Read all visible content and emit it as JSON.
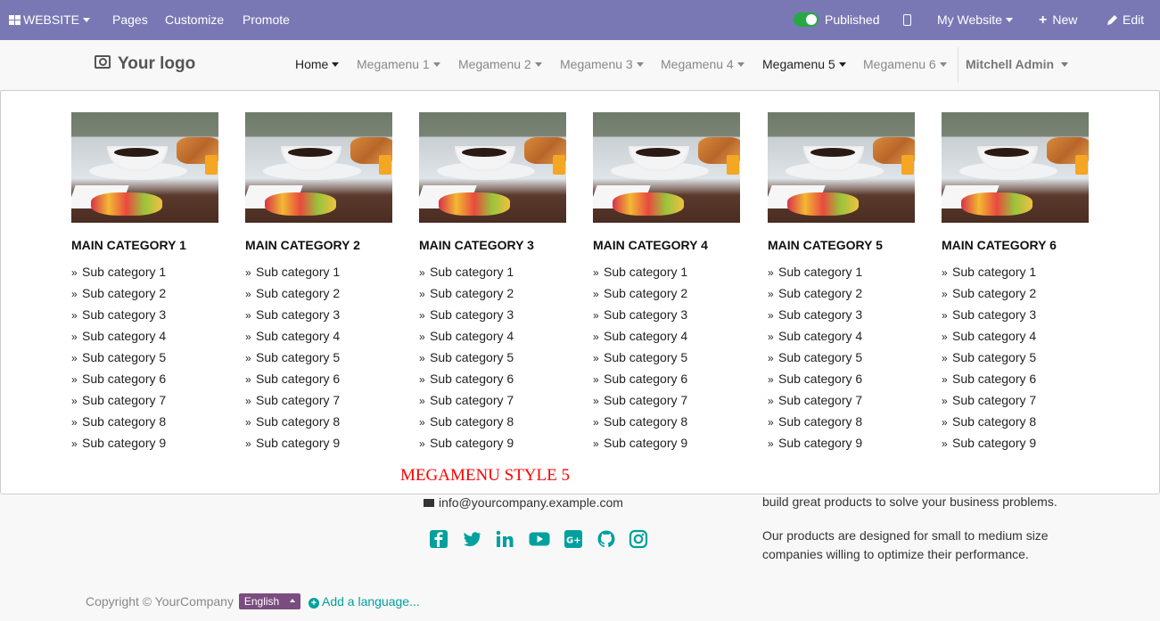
{
  "admin_bar": {
    "website_label": "WEBSITE",
    "pages_label": "Pages",
    "customize_label": "Customize",
    "promote_label": "Promote",
    "published_label": "Published",
    "my_website_label": "My Website",
    "new_label": "New",
    "edit_label": "Edit",
    "colors": {
      "background": "#7a78b4",
      "toggle_on": "#28a745"
    }
  },
  "navbar": {
    "logo_text": "Your logo",
    "items": [
      {
        "label": "Home",
        "active": true
      },
      {
        "label": "Megamenu 1",
        "active": false
      },
      {
        "label": "Megamenu 2",
        "active": false
      },
      {
        "label": "Megamenu 3",
        "active": false
      },
      {
        "label": "Megamenu 4",
        "active": false
      },
      {
        "label": "Megamenu 5",
        "active": true
      },
      {
        "label": "Megamenu 6",
        "active": false
      }
    ],
    "user_label": "Mitchell Admin"
  },
  "megamenu": {
    "style_label": "MEGAMENU STYLE 5",
    "label_color": "#ff0000",
    "columns": [
      {
        "title": "MAIN CATEGORY 1",
        "subs": [
          "Sub category 1",
          "Sub category 2",
          "Sub category 3",
          "Sub category 4",
          "Sub category 5",
          "Sub category 6",
          "Sub category 7",
          "Sub category 8",
          "Sub category 9"
        ]
      },
      {
        "title": "MAIN CATEGORY 2",
        "subs": [
          "Sub category 1",
          "Sub category 2",
          "Sub category 3",
          "Sub category 4",
          "Sub category 5",
          "Sub category 6",
          "Sub category 7",
          "Sub category 8",
          "Sub category 9"
        ]
      },
      {
        "title": "MAIN CATEGORY 3",
        "subs": [
          "Sub category 1",
          "Sub category 2",
          "Sub category 3",
          "Sub category 4",
          "Sub category 5",
          "Sub category 6",
          "Sub category 7",
          "Sub category 8",
          "Sub category 9"
        ]
      },
      {
        "title": "MAIN CATEGORY 4",
        "subs": [
          "Sub category 1",
          "Sub category 2",
          "Sub category 3",
          "Sub category 4",
          "Sub category 5",
          "Sub category 6",
          "Sub category 7",
          "Sub category 8",
          "Sub category 9"
        ]
      },
      {
        "title": "MAIN CATEGORY 5",
        "subs": [
          "Sub category 1",
          "Sub category 2",
          "Sub category 3",
          "Sub category 4",
          "Sub category 5",
          "Sub category 6",
          "Sub category 7",
          "Sub category 8",
          "Sub category 9"
        ]
      },
      {
        "title": "MAIN CATEGORY 6",
        "subs": [
          "Sub category 1",
          "Sub category 2",
          "Sub category 3",
          "Sub category 4",
          "Sub category 5",
          "Sub category 6",
          "Sub category 7",
          "Sub category 8",
          "Sub category 9"
        ]
      }
    ]
  },
  "footer": {
    "email": "info@yourcompany.example.com",
    "social_icons": [
      "facebook-icon",
      "twitter-icon",
      "linkedin-icon",
      "youtube-icon",
      "google-plus-icon",
      "github-icon",
      "instagram-icon"
    ],
    "about_line_1": "build great products to solve your business problems.",
    "about_para_2": "Our products are designed for small to medium size companies willing to optimize their performance.",
    "copyright": "Copyright © YourCompany",
    "language": "English",
    "add_language": "Add a language...",
    "accent_color": "#00a09d"
  }
}
